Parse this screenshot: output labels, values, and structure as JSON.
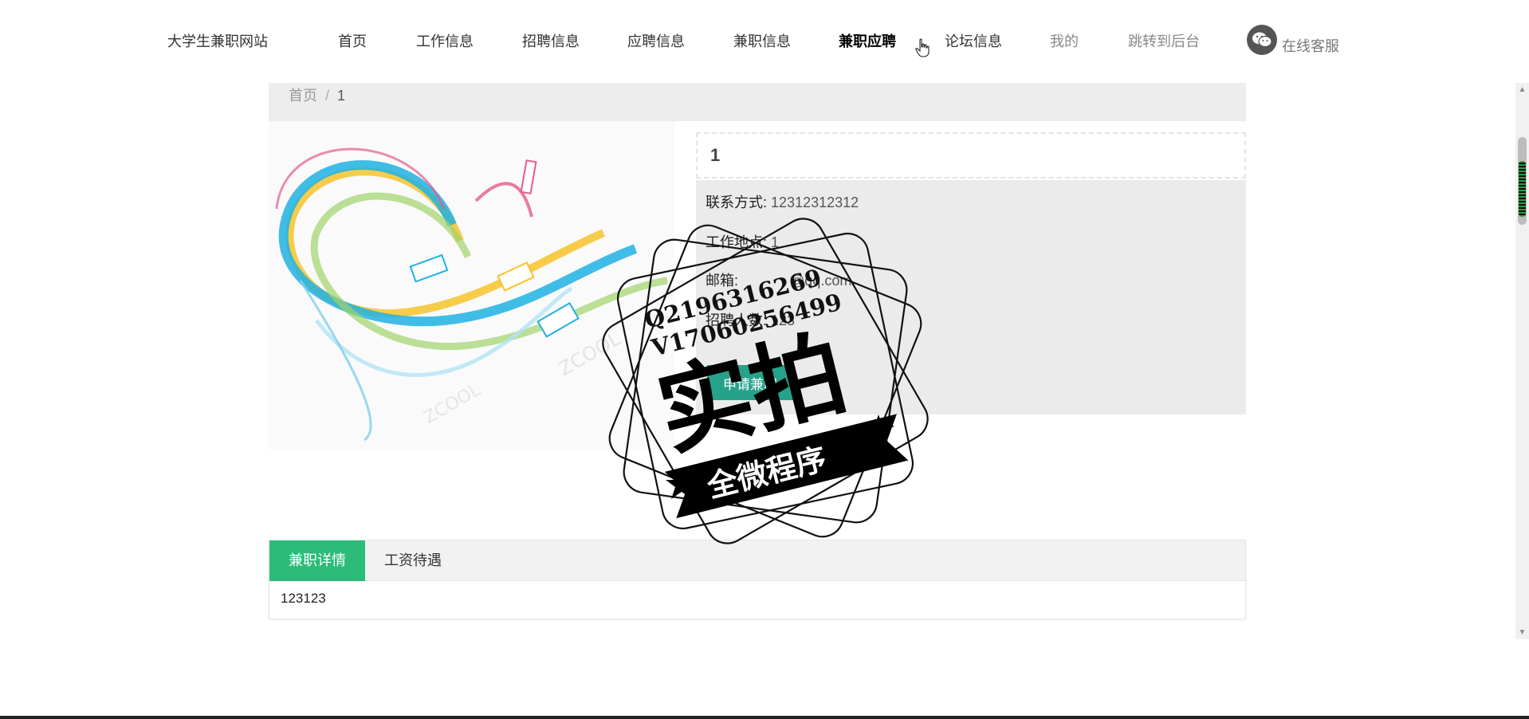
{
  "nav": {
    "brand": "大学生兼职网站",
    "items": [
      {
        "label": "首页"
      },
      {
        "label": "工作信息"
      },
      {
        "label": "招聘信息"
      },
      {
        "label": "应聘信息"
      },
      {
        "label": "兼职信息"
      },
      {
        "label": "兼职应聘",
        "active": true
      },
      {
        "label": "论坛信息"
      },
      {
        "label": "我的"
      },
      {
        "label": "跳转到后台"
      }
    ],
    "service_label": "在线客服",
    "service_icon": "wechat-icon"
  },
  "breadcrumb": {
    "home": "首页",
    "separator": "/",
    "current": "1"
  },
  "detail": {
    "title": "1",
    "contact_label": "联系方式:",
    "contact_value": "12312312312",
    "location_label": "工作地点:",
    "location_value": "1",
    "email_label": "邮箱:",
    "email_value": "@qq.com",
    "headcount_label": "招聘人数:",
    "headcount_value": "123",
    "apply_label": "申请兼职"
  },
  "tabs": {
    "items": [
      {
        "label": "兼职详情",
        "active": true
      },
      {
        "label": "工资待遇"
      }
    ],
    "content": "123123"
  },
  "watermark": {
    "line1": "Q2196316269",
    "line2": "V17060256499",
    "main": "实拍",
    "banner": "全微程序"
  },
  "colors": {
    "accent_green": "#2dbb78",
    "apply_teal": "#26a28a",
    "panel_gray": "#ebebeb"
  }
}
